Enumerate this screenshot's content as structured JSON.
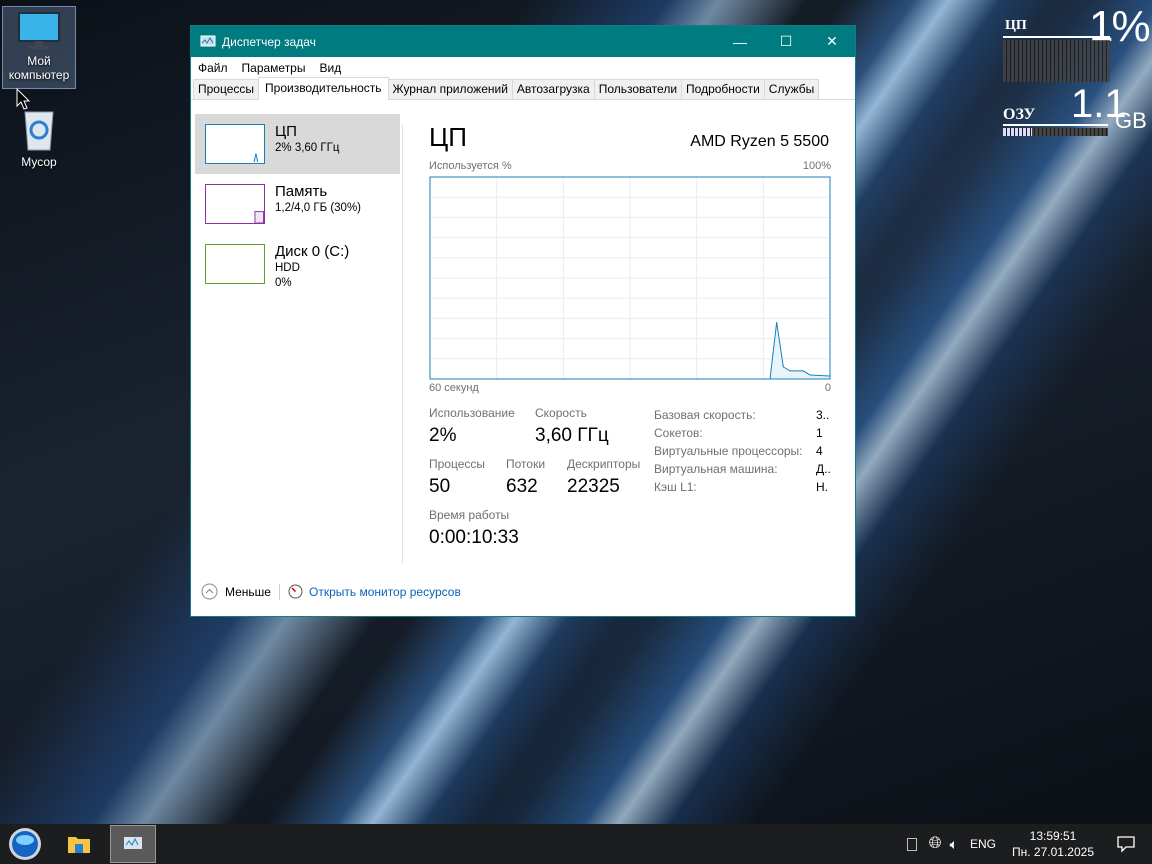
{
  "desktop": {
    "icons": [
      {
        "label": "Мой компьютер",
        "icon": "monitor-icon"
      },
      {
        "label": "Мусор",
        "icon": "recycle-bin-icon"
      }
    ]
  },
  "widget": {
    "cpu_label": "ЦП",
    "cpu_value": "1%",
    "ram_label": "ОЗУ",
    "ram_value": "1.1",
    "ram_unit": "GB",
    "cpu_fraction": 0.01,
    "ram_fraction": 0.28
  },
  "window": {
    "title": "Диспетчер задач",
    "minimize": "—",
    "maximize": "☐",
    "close": "✕",
    "accent": "#007c80",
    "menu": [
      "Файл",
      "Параметры",
      "Вид"
    ],
    "tabs": [
      "Процессы",
      "Производительность",
      "Журнал приложений",
      "Автозагрузка",
      "Пользователи",
      "Подробности",
      "Службы"
    ],
    "active_tab": 1,
    "sidebar": [
      {
        "name": "ЦП",
        "line1": "2% 3,60 ГГц",
        "line2": "",
        "color": "#1a7fb5"
      },
      {
        "name": "Память",
        "line1": "1,2/4,0 ГБ (30%)",
        "line2": "",
        "color": "#8b2fa3"
      },
      {
        "name": "Диск 0 (C:)",
        "line1": "HDD",
        "line2": "0%",
        "color": "#5fa22a"
      }
    ],
    "main": {
      "title": "ЦП",
      "cpu_model": "AMD Ryzen 5 5500",
      "graph_label": "Используется %",
      "graph_max": "100%",
      "graph_left": "60 секунд",
      "graph_right": "0",
      "stats": {
        "usage_label": "Использование",
        "usage": "2%",
        "speed_label": "Скорость",
        "speed": "3,60 ГГц",
        "proc_label": "Процессы",
        "proc": "50",
        "threads_label": "Потоки",
        "threads": "632",
        "handles_label": "Дескрипторы",
        "handles": "22325",
        "uptime_label": "Время работы",
        "uptime": "0:00:10:33"
      },
      "details": [
        [
          "Базовая скорость:",
          "3.."
        ],
        [
          "Сокетов:",
          "1"
        ],
        [
          "Виртуальные процессоры:",
          "4"
        ],
        [
          "Виртуальная машина:",
          "Д.."
        ],
        [
          "Кэш L1:",
          "Н."
        ]
      ]
    },
    "footer": {
      "less": "Меньше",
      "monitor": "Открыть монитор ресурсов"
    }
  },
  "chart_data": {
    "type": "area",
    "xlabel": "",
    "ylabel": "Используется %",
    "xlim": [
      60,
      0
    ],
    "ylim": [
      0,
      100
    ],
    "grid": true,
    "x": [
      60,
      9,
      8,
      7,
      6,
      4,
      3,
      0
    ],
    "values": [
      0,
      0,
      28,
      6,
      4,
      4,
      2,
      1.5
    ]
  },
  "taskbar": {
    "time": "13:59:51",
    "date": "Пн. 27.01.2025",
    "lang": "ENG"
  }
}
